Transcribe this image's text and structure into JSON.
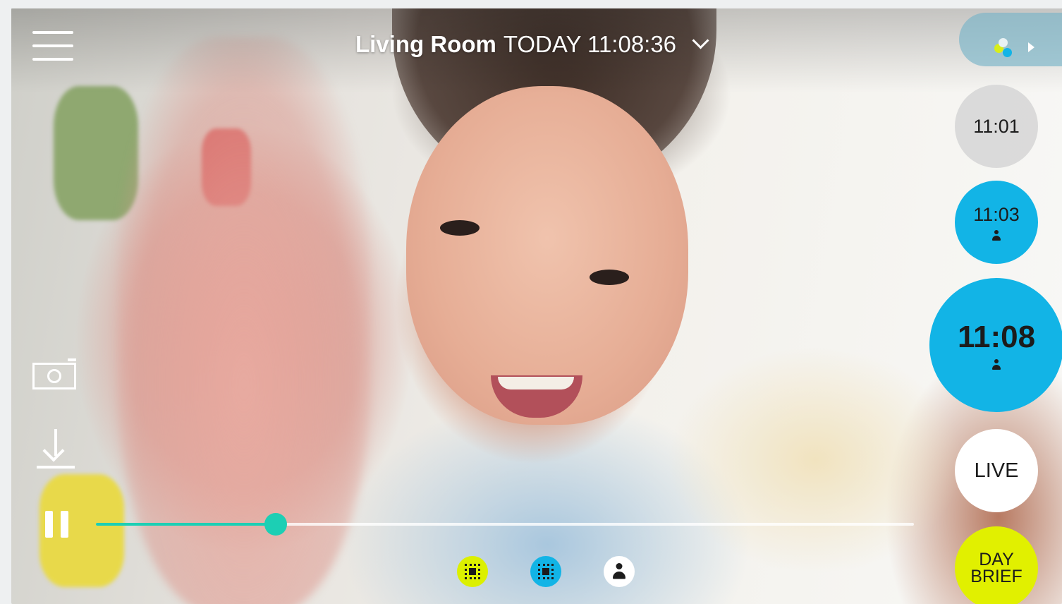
{
  "header": {
    "room_name": "Living Room",
    "timestamp": "TODAY 11:08:36",
    "dropdown_icon": "chevron-down-icon",
    "menu_icon": "hamburger-menu-icon",
    "brand_icon": "logo-dots-icon"
  },
  "timeline": {
    "events": [
      {
        "time": "11:01",
        "style": "gray",
        "has_person": false
      },
      {
        "time": "11:03",
        "style": "blue",
        "has_person": true
      },
      {
        "time": "11:08",
        "style": "blue-large",
        "has_person": true
      }
    ],
    "live_label": "LIVE",
    "day_brief_label_line1": "DAY",
    "day_brief_label_line2": "BRIEF"
  },
  "controls": {
    "snapshot_icon": "camera-icon",
    "download_icon": "download-icon",
    "pause_icon": "pause-icon",
    "playback_progress": 0.22
  },
  "filters": [
    {
      "name": "motion-filter-yellow",
      "icon": "zone-grid-icon",
      "color": "#dcf000"
    },
    {
      "name": "motion-filter-blue",
      "icon": "zone-grid-icon",
      "color": "#12b4e6"
    },
    {
      "name": "person-filter",
      "icon": "person-icon",
      "color": "#ffffff"
    }
  ],
  "colors": {
    "accent_blue": "#12b4e6",
    "accent_yellow": "#e1f000",
    "scrubber_teal": "#1ccfb4"
  }
}
